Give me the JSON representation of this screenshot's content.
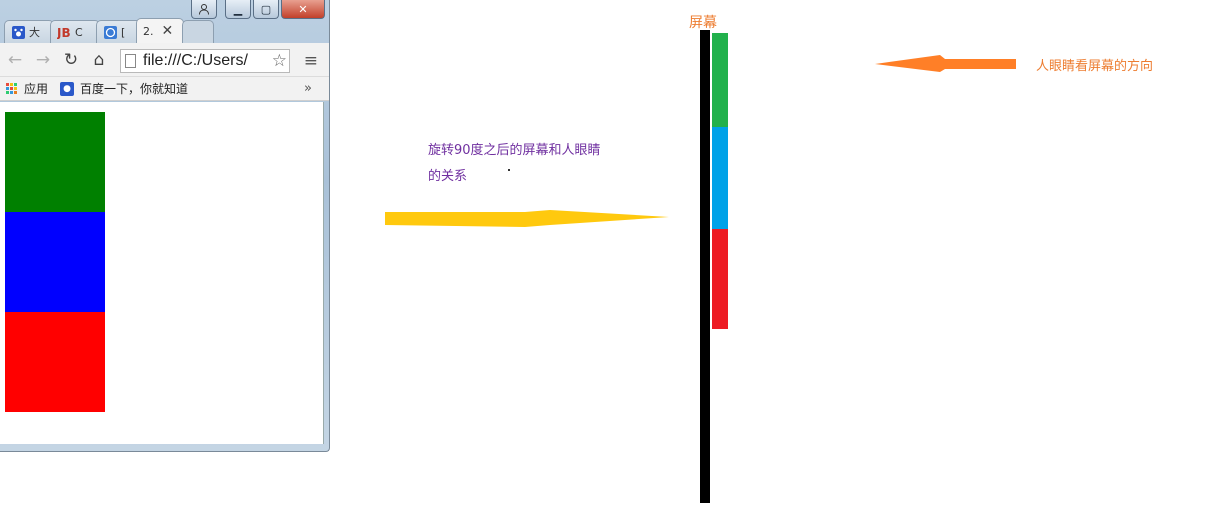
{
  "browser": {
    "tabs": [
      {
        "title": "大",
        "favicon": "baidu-paw"
      },
      {
        "title": "C",
        "favicon": "jb-logo"
      },
      {
        "title": "[",
        "favicon": "globe-logo"
      },
      {
        "title": "2.",
        "favicon": "none"
      }
    ],
    "address": "file:///C:/Users/",
    "bookmarks": [
      {
        "label": "应用",
        "icon": "apps-grid"
      },
      {
        "label": "百度一下，你就知道",
        "icon": "baidu-paw"
      }
    ],
    "more": "»",
    "blocks": [
      {
        "color": "#008000"
      },
      {
        "color": "#0000ff"
      },
      {
        "color": "#ff0000"
      }
    ]
  },
  "annotations": {
    "screen_label": "屏幕",
    "eye_direction": "人眼睛看屏幕的方向",
    "rotation_text_line1": "旋转90度之后的屏幕和人眼睛",
    "rotation_text_line2": "的关系"
  },
  "screen_segments": [
    {
      "color": "#22b14c"
    },
    {
      "color": "#00a2e8"
    },
    {
      "color": "#ed1c24"
    }
  ],
  "colors": {
    "orange": "#ed7d31",
    "purple": "#7030a0",
    "yellow": "#ffc90e",
    "arrow_orange": "#ff7f27"
  }
}
